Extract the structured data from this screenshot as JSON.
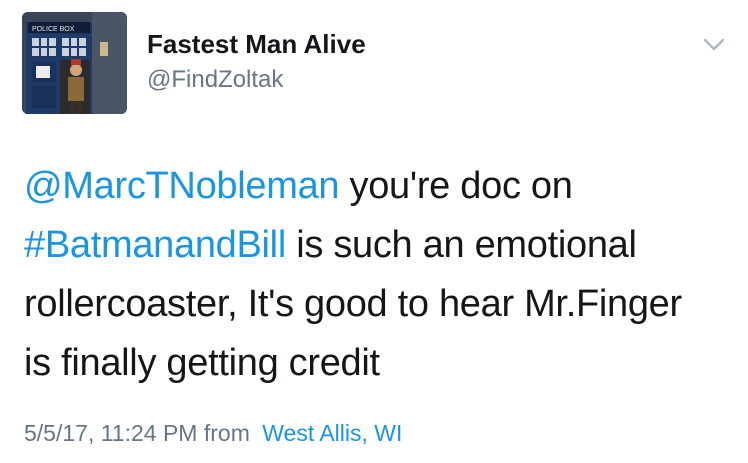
{
  "user": {
    "display_name": "Fastest Man Alive",
    "username": "@FindZoltak",
    "avatar_sign_text": "POLICE BOX"
  },
  "tweet": {
    "line1_mention": "@MarcTNobleman",
    "line1_text": " you're doc on",
    "line2_hashtag": "#BatmanandBill",
    "line2_text": " is such an emotional",
    "line3_text": "rollercoaster, It's good to hear Mr.Finger",
    "line4_text": "is finally getting credit"
  },
  "meta": {
    "timestamp": "5/5/17, 11:24 PM",
    "from_label": "from",
    "location": "West Allis, WI"
  },
  "icons": {
    "menu": "chevron-down-icon"
  },
  "colors": {
    "link": "#1b95e0",
    "secondary_text": "#657786",
    "primary_text": "#14171a"
  }
}
